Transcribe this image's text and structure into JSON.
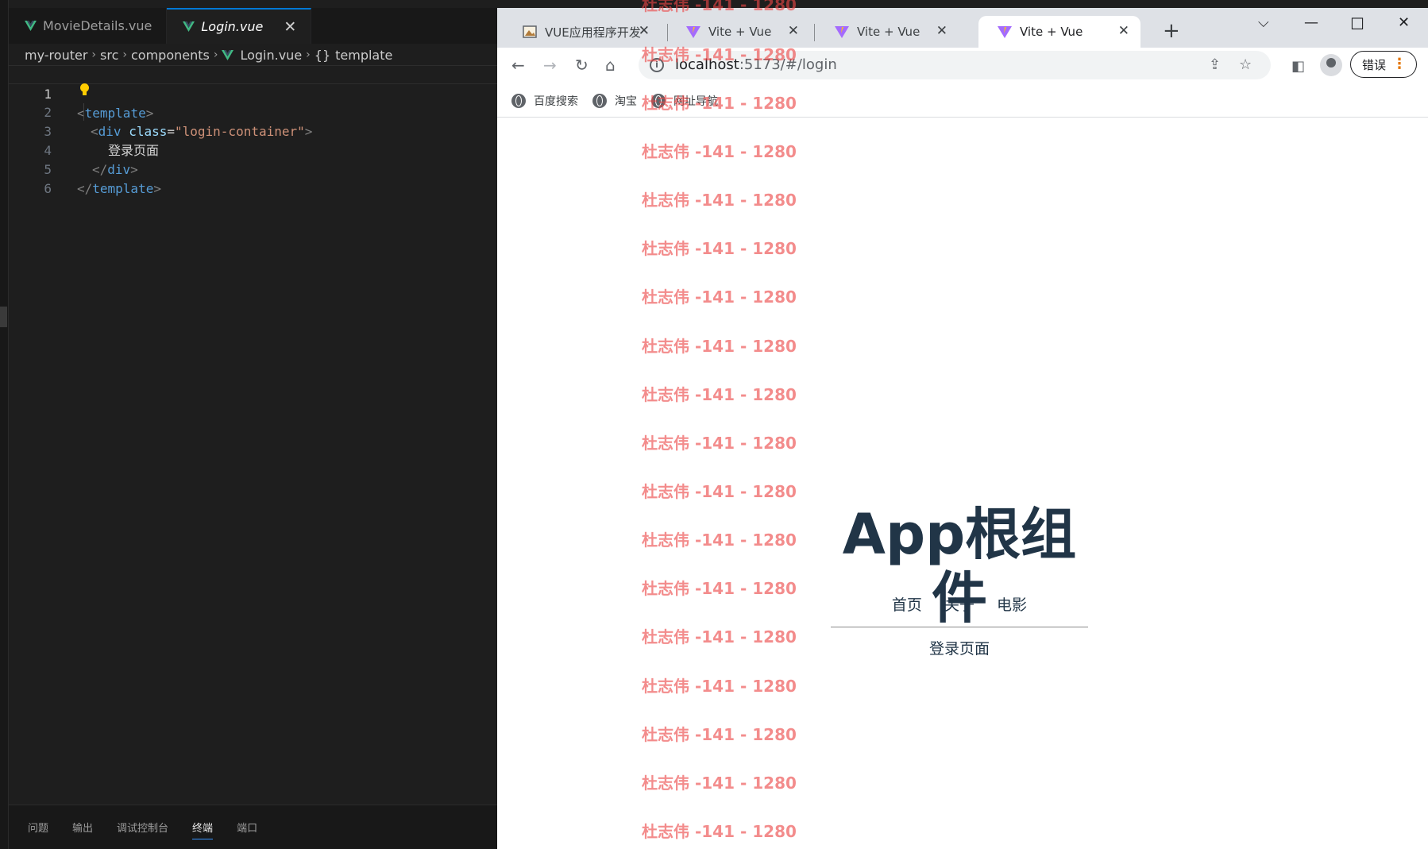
{
  "editor": {
    "tabs": [
      {
        "label": "MovieDetails.vue",
        "active": false
      },
      {
        "label": "Login.vue",
        "active": true
      }
    ],
    "breadcrumb": [
      "my-router",
      "src",
      "components",
      "Login.vue",
      "template"
    ],
    "line_numbers": [
      "1",
      "2",
      "3",
      "4",
      "5",
      "6"
    ],
    "code": {
      "l1_open": "<",
      "l1_tag": "template",
      "l1_close": ">",
      "l2_open": "<",
      "l2_tag": "div",
      "l2_attr": "class",
      "l2_eq": "=",
      "l2_value": "\"login-container\"",
      "l2_close": ">",
      "l3_text": "登录页面",
      "l4_open": "</",
      "l4_tag": "div",
      "l4_close": ">",
      "l5_open": "</",
      "l5_tag": "template",
      "l5_close": ">"
    },
    "panel_tabs": [
      {
        "label": "问题",
        "active": false
      },
      {
        "label": "输出",
        "active": false
      },
      {
        "label": "调试控制台",
        "active": false
      },
      {
        "label": "终端",
        "active": true
      },
      {
        "label": "端口",
        "active": false
      }
    ]
  },
  "browser": {
    "tabs": [
      {
        "title": "VUE应用程序开发",
        "active": false
      },
      {
        "title": "Vite + Vue",
        "active": false
      },
      {
        "title": "Vite + Vue",
        "active": false
      },
      {
        "title": "Vite + Vue",
        "active": true
      }
    ],
    "address": {
      "host": "localhost",
      "path": ":5173/#/login"
    },
    "error_button": "错误",
    "bookmarks": [
      "百度搜索",
      "淘宝",
      "网址导航"
    ]
  },
  "page": {
    "title": "App根组件",
    "nav": [
      "首页",
      "关于",
      "电影"
    ],
    "content": "登录页面"
  },
  "watermark": {
    "text": "杜志伟 -141 - 1280",
    "color": "#eb4646"
  },
  "colors": {
    "vscode_bg": "#1e1e1e",
    "vue_green": "#41b883",
    "vue_dark": "#35495e",
    "accent_blue": "#0078d4",
    "vue_text": "#213547"
  }
}
